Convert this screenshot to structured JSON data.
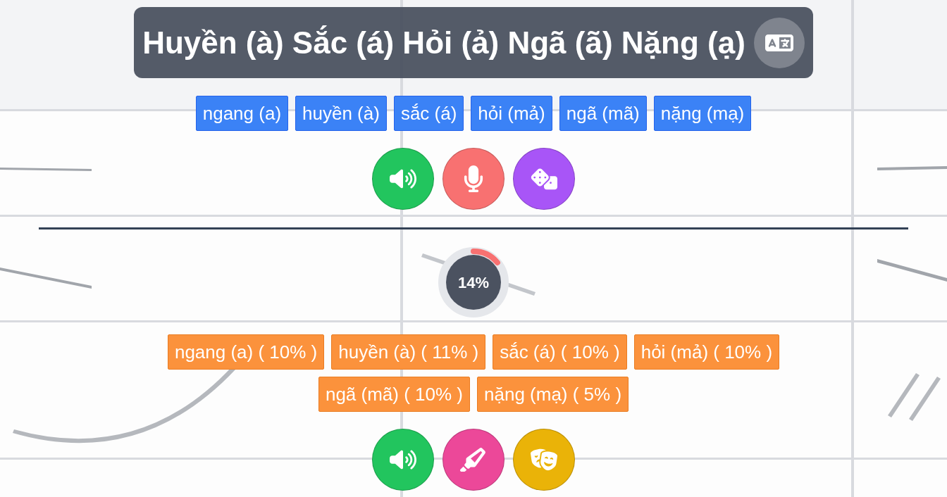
{
  "title": "Huyền (à) Sắc (á) Hỏi (ả) Ngã (ã) Nặng (ạ)",
  "tones": [
    "ngang (a)",
    "huyền (à)",
    "sắc (á)",
    "hỏi (mả)",
    "ngã (mã)",
    "nặng (mạ)"
  ],
  "practice_buttons": [
    {
      "kind": "speaker",
      "color": "#22c55e"
    },
    {
      "kind": "microphone",
      "color": "#f87171"
    },
    {
      "kind": "dice",
      "color": "#a855f7"
    }
  ],
  "progress": {
    "level": 0.14,
    "reading": "14%"
  },
  "results": [
    "ngang (a) ( 10% )",
    "huyền (à) ( 11% )",
    "sắc (á) ( 10% )",
    "hỏi (mả) ( 10% )",
    "ngã (mã) ( 10% )",
    "nặng (mạ) ( 5% )"
  ],
  "result_buttons": [
    {
      "kind": "speaker",
      "color": "#22c55e"
    },
    {
      "kind": "highlighter",
      "color": "#ec4899"
    },
    {
      "kind": "masks",
      "color": "#eab308"
    }
  ]
}
